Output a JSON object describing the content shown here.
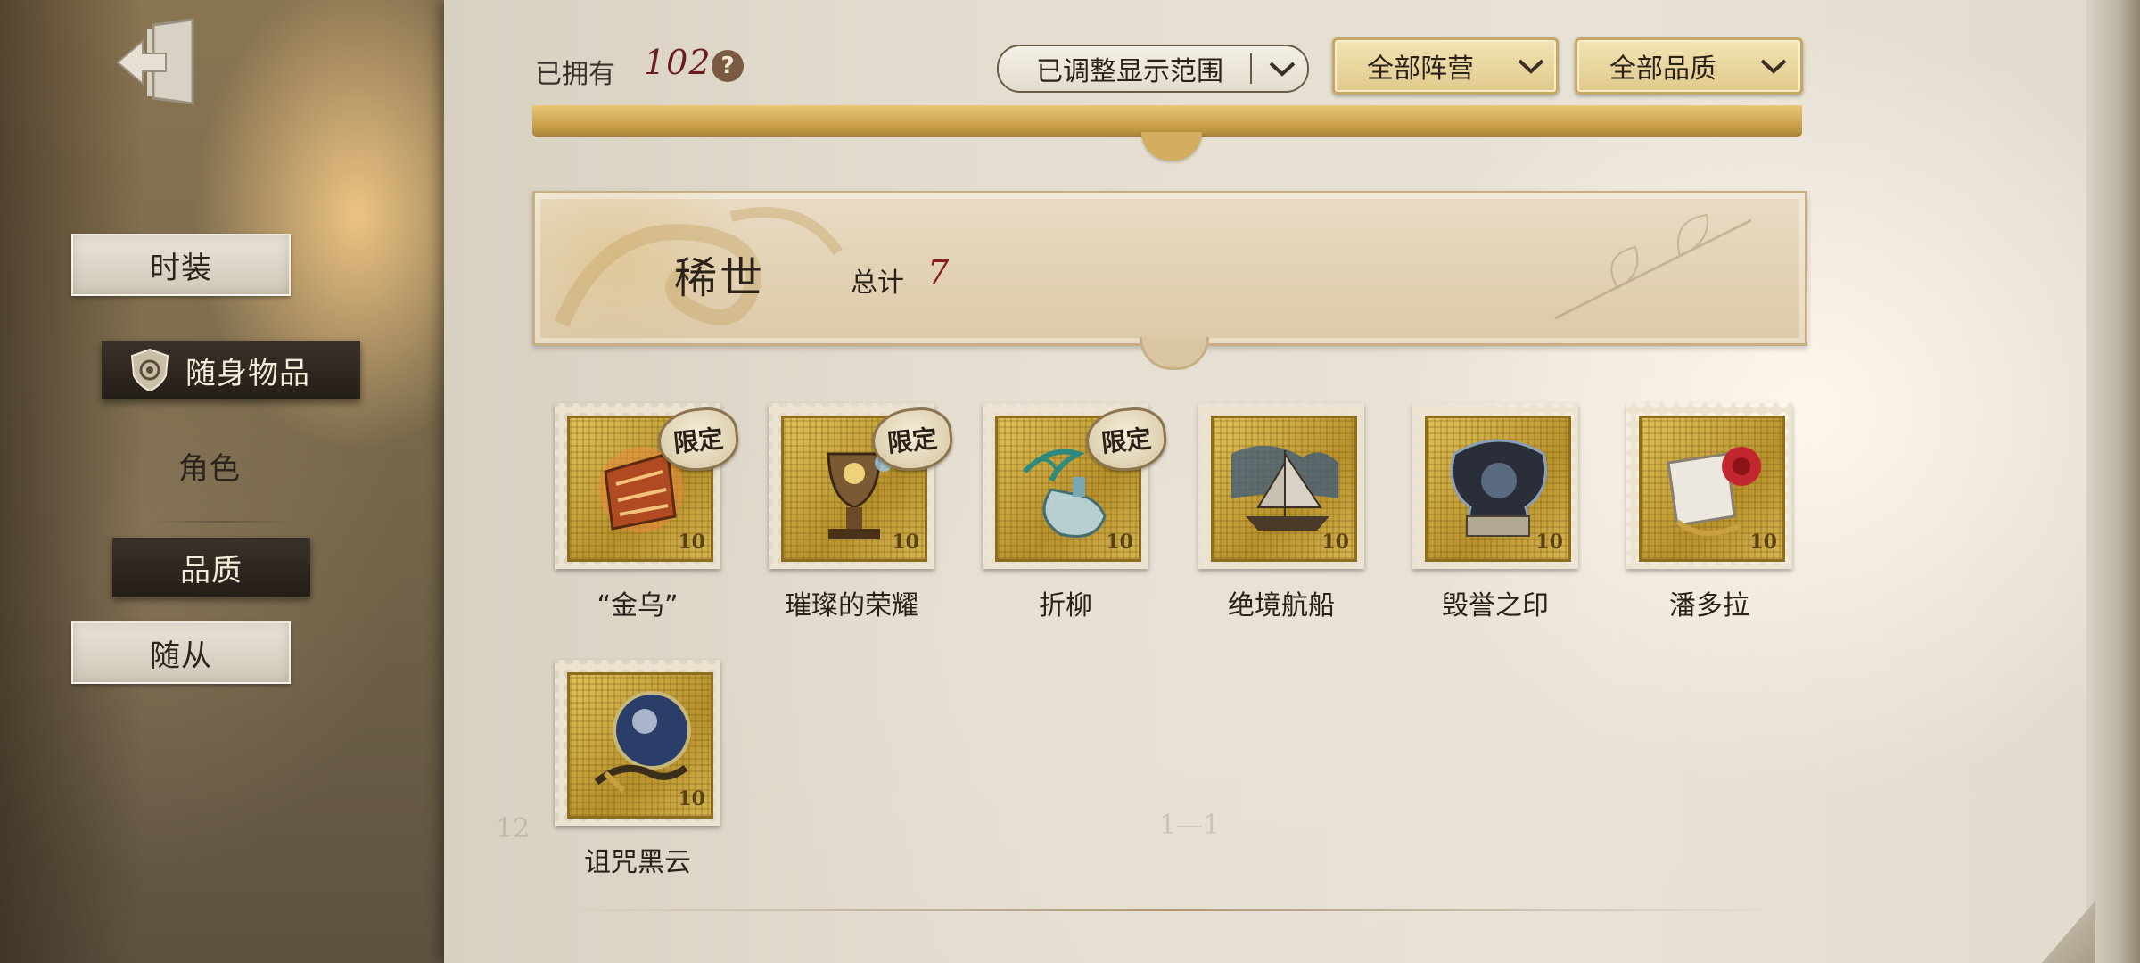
{
  "sidebar": {
    "items": [
      {
        "label": "时装"
      },
      {
        "label": "随身物品"
      },
      {
        "label": "角色"
      },
      {
        "label": "品质"
      },
      {
        "label": "随从"
      }
    ]
  },
  "header": {
    "owned_label": "已拥有",
    "owned_count": "102",
    "help_glyph": "?",
    "range_dropdown": "已调整显示范围",
    "faction_dropdown": "全部阵营",
    "quality_dropdown": "全部品质"
  },
  "section": {
    "title": "稀世",
    "total_label": "总计",
    "total_value": "7"
  },
  "items": [
    {
      "name": "“金乌”",
      "limited": true,
      "badge": "限定",
      "value": "10",
      "icon": "golden-crow-icon",
      "accent": "#c9632a"
    },
    {
      "name": "璀璨的荣耀",
      "limited": true,
      "badge": "限定",
      "value": "10",
      "icon": "glory-trophy-icon",
      "accent": "#8a6a3a"
    },
    {
      "name": "折柳",
      "limited": true,
      "badge": "限定",
      "value": "10",
      "icon": "willow-bottle-icon",
      "accent": "#5aa6a0"
    },
    {
      "name": "绝境航船",
      "limited": false,
      "badge": "",
      "value": "10",
      "icon": "ship-icon",
      "accent": "#4b6a8a"
    },
    {
      "name": "毁誉之印",
      "limited": false,
      "badge": "",
      "value": "10",
      "icon": "dark-seal-icon",
      "accent": "#2f3440"
    },
    {
      "name": "潘多拉",
      "limited": false,
      "badge": "",
      "value": "10",
      "icon": "pandora-rose-icon",
      "accent": "#c2262e"
    },
    {
      "name": "诅咒黑云",
      "limited": false,
      "badge": "",
      "value": "10",
      "icon": "cursed-cloud-orb-icon",
      "accent": "#2b3e6a"
    }
  ]
}
